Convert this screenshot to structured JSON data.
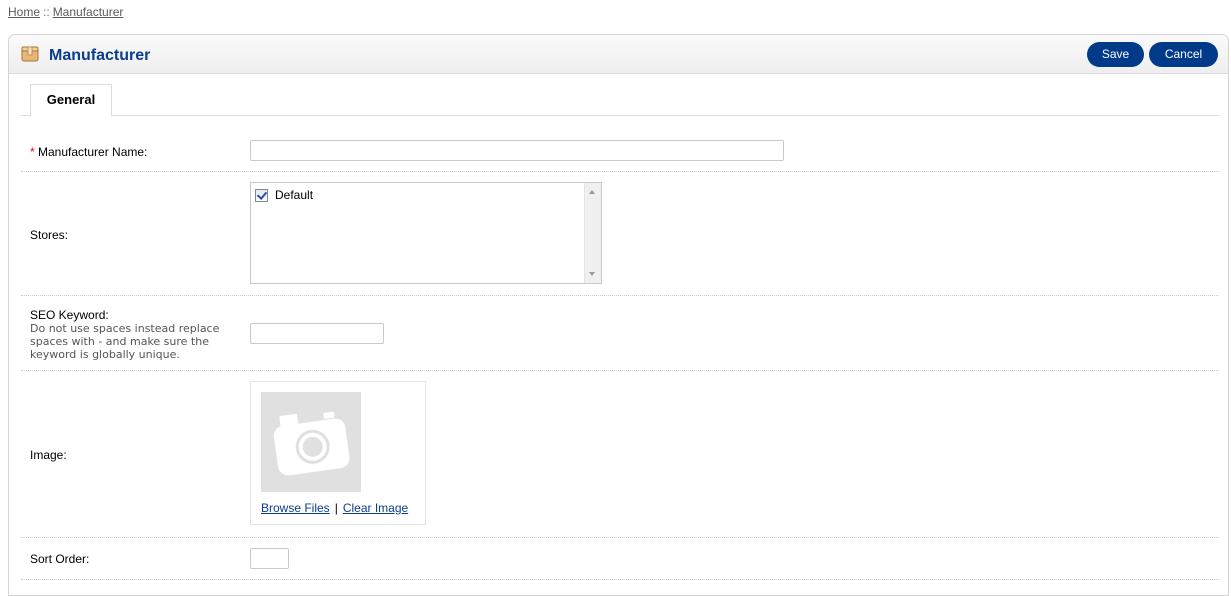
{
  "breadcrumb": {
    "items": [
      "Home",
      "Manufacturer"
    ],
    "separator": "::"
  },
  "header": {
    "icon": "package-box-icon",
    "title": "Manufacturer",
    "save_label": "Save",
    "cancel_label": "Cancel",
    "button_color": "#003a88",
    "title_color": "#0a3e8c"
  },
  "tabs": [
    {
      "label": "General",
      "active": true
    }
  ],
  "form": {
    "manufacturer_name": {
      "required_mark": "*",
      "label": "Manufacturer Name:",
      "value": ""
    },
    "stores": {
      "label": "Stores:",
      "options": [
        {
          "label": "Default",
          "checked": true
        }
      ]
    },
    "seo_keyword": {
      "label": "SEO Keyword:",
      "help": "Do not use spaces instead replace spaces with - and make sure the keyword is globally unique.",
      "value": ""
    },
    "image": {
      "label": "Image:",
      "placeholder_icon": "camera-icon",
      "browse_label": "Browse Files",
      "separator": "|",
      "clear_label": "Clear Image"
    },
    "sort_order": {
      "label": "Sort Order:",
      "value": ""
    }
  }
}
